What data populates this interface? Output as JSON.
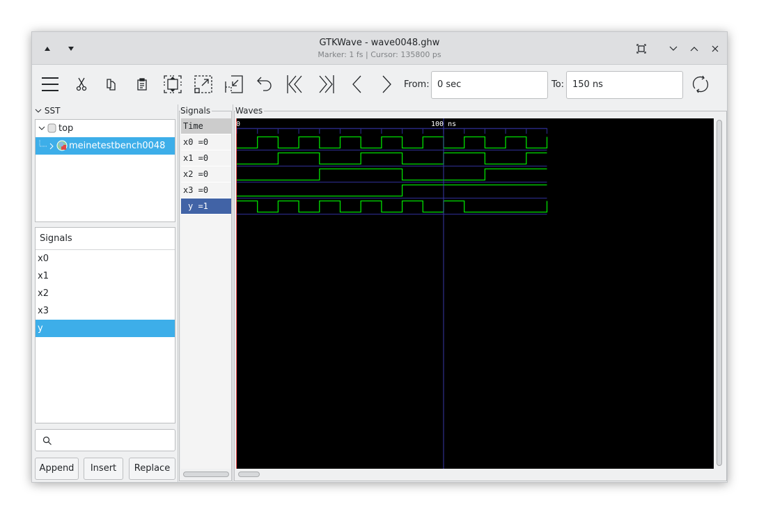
{
  "window": {
    "title": "GTKWave - wave0048.ghw",
    "subtitle": "Marker: 1 fs  |  Cursor: 135800 ps",
    "left_buttons": [
      "move-up",
      "move-down"
    ],
    "right_buttons": [
      "fullscreen",
      "minimize",
      "maximize",
      "close"
    ]
  },
  "toolbar": {
    "icons": [
      "menu-icon",
      "cut-icon",
      "copy-icon",
      "paste-icon",
      "zoom-fit-icon",
      "zoom-in-icon",
      "zoom-out-icon",
      "undo-icon",
      "jump-start-icon",
      "jump-end-icon",
      "prev-icon",
      "next-icon"
    ],
    "from_label": "From:",
    "from_value": "0 sec",
    "to_label": "To:",
    "to_value": "150 ns",
    "reload_icon": "reload-icon"
  },
  "sst": {
    "label": "SST",
    "tree": [
      {
        "label": "top",
        "expanded": true,
        "icon": "module-icon"
      },
      {
        "label": "meinetestbench0048",
        "expanded": false,
        "selected": true,
        "icon": "testbench-icon"
      }
    ],
    "signals_header": "Signals",
    "signals": [
      "x0",
      "x1",
      "x2",
      "x3",
      "y"
    ],
    "selected_signal": "y",
    "search_placeholder": "",
    "buttons": {
      "append": "Append",
      "insert": "Insert",
      "replace": "Replace"
    }
  },
  "signals_panel": {
    "title": "Signals",
    "time_label": "Time",
    "rows": [
      {
        "label": "x0 =0"
      },
      {
        "label": "x1 =0"
      },
      {
        "label": "x2 =0"
      },
      {
        "label": "x3 =0"
      },
      {
        "label": "y =1",
        "selected": true
      }
    ]
  },
  "waves_panel": {
    "title": "Waves",
    "ruler": {
      "start_label": "0",
      "marker_label": "100 ns"
    },
    "time_range_ns": [
      0,
      150
    ],
    "tick_step_ns": 10,
    "cursor_ns": 100,
    "marker_ns": 0,
    "colors": {
      "wave": "#00e000",
      "grid": "#282880",
      "cursor": "#3838a8",
      "marker": "#ff6060",
      "background": "#000000"
    },
    "waveforms": [
      {
        "name": "x0",
        "transitions": [
          [
            0,
            0
          ],
          [
            10,
            1
          ],
          [
            20,
            0
          ],
          [
            30,
            1
          ],
          [
            40,
            0
          ],
          [
            50,
            1
          ],
          [
            60,
            0
          ],
          [
            70,
            1
          ],
          [
            80,
            0
          ],
          [
            90,
            1
          ],
          [
            100,
            0
          ],
          [
            110,
            1
          ],
          [
            120,
            0
          ],
          [
            130,
            1
          ],
          [
            140,
            0
          ],
          [
            150,
            1
          ]
        ]
      },
      {
        "name": "x1",
        "transitions": [
          [
            0,
            0
          ],
          [
            20,
            1
          ],
          [
            40,
            0
          ],
          [
            60,
            1
          ],
          [
            80,
            0
          ],
          [
            100,
            1
          ],
          [
            120,
            0
          ],
          [
            140,
            1
          ]
        ]
      },
      {
        "name": "x2",
        "transitions": [
          [
            0,
            0
          ],
          [
            40,
            1
          ],
          [
            80,
            0
          ],
          [
            120,
            1
          ]
        ]
      },
      {
        "name": "x3",
        "transitions": [
          [
            0,
            0
          ],
          [
            80,
            1
          ]
        ]
      },
      {
        "name": "y",
        "transitions": [
          [
            0,
            1
          ],
          [
            10,
            0
          ],
          [
            20,
            1
          ],
          [
            30,
            0
          ],
          [
            40,
            1
          ],
          [
            50,
            0
          ],
          [
            60,
            1
          ],
          [
            70,
            0
          ],
          [
            80,
            1
          ],
          [
            90,
            0
          ],
          [
            100,
            1
          ],
          [
            110,
            0
          ],
          [
            150,
            1
          ]
        ]
      }
    ]
  }
}
